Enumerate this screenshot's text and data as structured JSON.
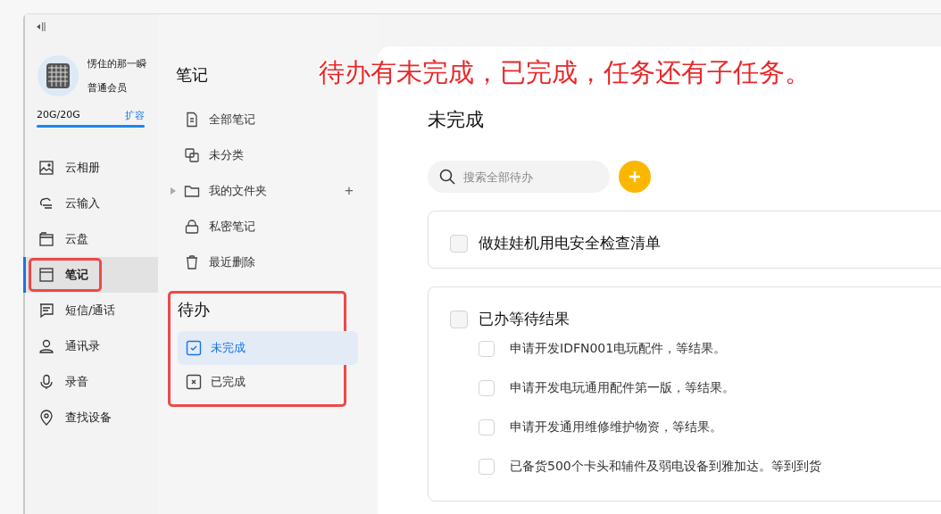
{
  "annotation": {
    "text": "待办有未完成，已完成，任务还有子任务。"
  },
  "user": {
    "name": "愣住的那一瞬",
    "tier": "普通会员",
    "storage": "20G/20G",
    "expand_link": "扩容",
    "level": 1
  },
  "nav": [
    {
      "label": "云相册",
      "kind": "photo",
      "selected": false,
      "annotated": false
    },
    {
      "label": "云输入",
      "kind": "cloud",
      "selected": false,
      "annotated": false
    },
    {
      "label": "云盘",
      "kind": "disk",
      "selected": false,
      "annotated": false
    },
    {
      "label": "笔记",
      "kind": "note",
      "selected": true,
      "annotated": true
    },
    {
      "label": "短信/通话",
      "kind": "message",
      "selected": false,
      "annotated": false
    },
    {
      "label": "通讯录",
      "kind": "contact",
      "selected": false,
      "annotated": false
    },
    {
      "label": "录音",
      "kind": "mic",
      "selected": false,
      "annotated": false
    },
    {
      "label": "查找设备",
      "kind": "pin",
      "selected": false,
      "annotated": false
    }
  ],
  "notes": {
    "title": "笔记",
    "items": [
      {
        "label": "全部笔记",
        "kind": "doc"
      },
      {
        "label": "未分类",
        "kind": "copy"
      },
      {
        "label": "我的文件夹",
        "kind": "folder",
        "add": "+"
      },
      {
        "label": "私密笔记",
        "kind": "lock"
      },
      {
        "label": "最近删除",
        "kind": "trash"
      }
    ]
  },
  "todo": {
    "title": "待办",
    "annotated": true,
    "items": [
      {
        "label": "未完成",
        "kind": "check",
        "selected": true
      },
      {
        "label": "已完成",
        "kind": "cross",
        "selected": false
      }
    ]
  },
  "main": {
    "title": "未完成",
    "search": {
      "placeholder": "搜索全部待办"
    },
    "tasks": [
      {
        "title": "做娃娃机用电安全检查清单",
        "checked": false
      },
      {
        "title": "已办等待结果",
        "checked": false,
        "children": [
          {
            "title": "申请开发IDFN001电玩配件，等结果。",
            "checked": false
          },
          {
            "title": "申请开发电玩通用配件第一版，等结果。",
            "checked": false
          },
          {
            "title": "申请开发通用维修维护物资，等结果。",
            "checked": false
          },
          {
            "title": "已备货500个卡头和辅件及弱电设备到雅加达。等到到货",
            "checked": false
          }
        ]
      }
    ]
  }
}
